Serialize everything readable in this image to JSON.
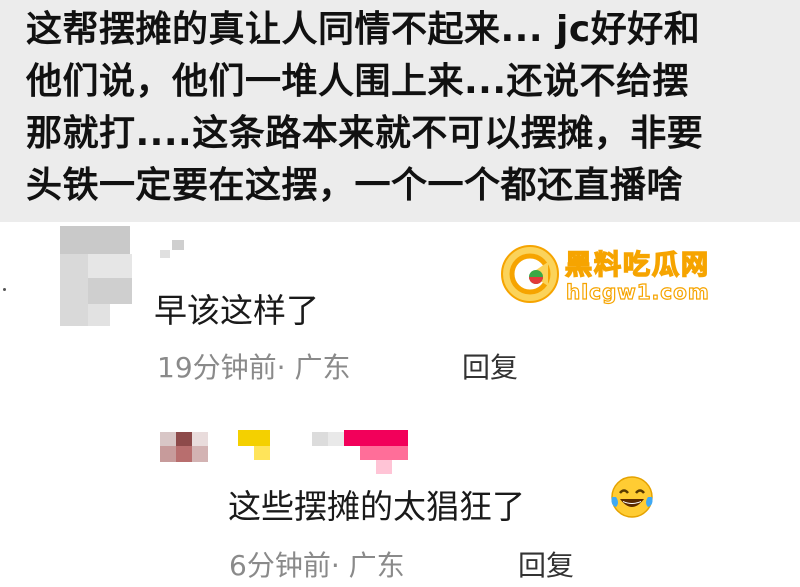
{
  "post": {
    "lines": [
      "这帮摆摊的真让人同情不起来... jc好好和",
      "他们说，他们一堆人围上来...还说不给摆",
      "那就打....这条路本来就不可以摆摊，非要",
      "头铁一定要在这摆，一个一个都还直播啥"
    ]
  },
  "watermark": {
    "title": "黑料吃瓜网",
    "url": "hlcgw1.com"
  },
  "comments": [
    {
      "text": "早该这样了",
      "time": "19分钟前",
      "location": "· 广东",
      "reply_label": "回复"
    },
    {
      "text": "这些摆摊的太猖狂了",
      "emoji": "laughing-tears-emoji",
      "time": "6分钟前",
      "location": "· 广东",
      "reply_label": "回复"
    }
  ],
  "colors": {
    "post_background": "#ececec",
    "meta_gray": "#8a8a8a",
    "watermark_orange": "#f6a400"
  }
}
